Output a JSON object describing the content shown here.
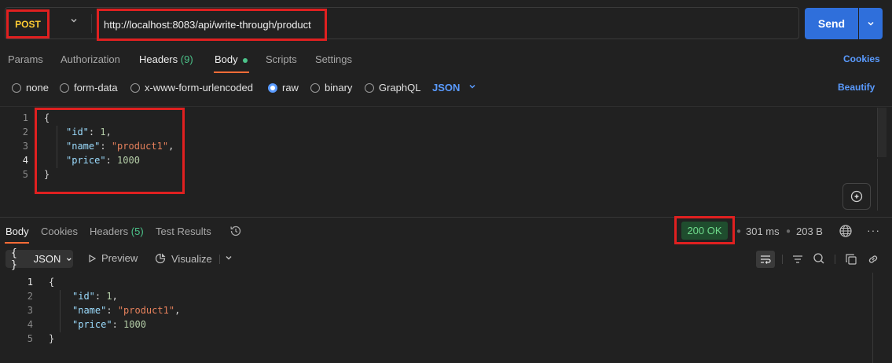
{
  "request": {
    "method": "POST",
    "url": "http://localhost:8083/api/write-through/product",
    "send_label": "Send"
  },
  "request_tabs": {
    "params": "Params",
    "authorization": "Authorization",
    "headers": "Headers",
    "headers_count": "(9)",
    "body": "Body",
    "scripts": "Scripts",
    "settings": "Settings",
    "cookies": "Cookies"
  },
  "body_types": {
    "none": "none",
    "form_data": "form-data",
    "urlencoded": "x-www-form-urlencoded",
    "raw": "raw",
    "binary": "binary",
    "graphql": "GraphQL",
    "selected": "raw",
    "language": "JSON",
    "beautify": "Beautify"
  },
  "request_body": {
    "line_numbers": [
      "1",
      "2",
      "3",
      "4",
      "5"
    ],
    "current_line": 4,
    "open": "{",
    "id_key": "\"id\"",
    "id_val": "1",
    "name_key": "\"name\"",
    "name_val": "\"product1\"",
    "price_key": "\"price\"",
    "price_val": "1000",
    "close": "}"
  },
  "response_tabs": {
    "body": "Body",
    "cookies": "Cookies",
    "headers": "Headers",
    "headers_count": "(5)",
    "test_results": "Test Results"
  },
  "response_meta": {
    "status": "200 OK",
    "time": "301 ms",
    "size": "203 B",
    "status_color": "#6fdc8c"
  },
  "response_toolbar": {
    "format": "JSON",
    "format_icon": "{ }",
    "preview": "Preview",
    "visualize": "Visualize"
  },
  "response_body": {
    "line_numbers": [
      "1",
      "2",
      "3",
      "4",
      "5"
    ],
    "open": "{",
    "id_key": "\"id\"",
    "id_val": "1",
    "name_key": "\"name\"",
    "name_val": "\"product1\"",
    "price_key": "\"price\"",
    "price_val": "1000",
    "close": "}"
  },
  "colors": {
    "accent": "#2f6fdb",
    "method": "#ffcc33",
    "highlight_border": "#e02020",
    "active_tab_underline": "#ff6c37"
  }
}
